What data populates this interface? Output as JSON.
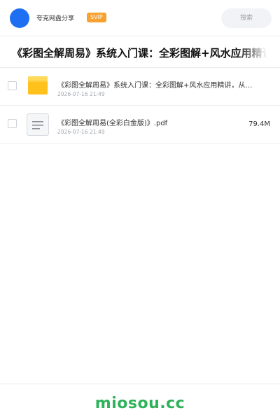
{
  "header": {
    "app_name": "夸克网盘分享",
    "badge": "SVIP",
    "search_placeholder": "搜索"
  },
  "title": "《彩图全解周易》系统入门课：全彩图解+风水应用精讲，从易经基础到实践，读懂古人的智慧",
  "files": [
    {
      "type": "folder",
      "name": "《彩图全解周易》系统入门课：全彩图解+风水应用精讲，从易经基础到实践",
      "date": "2026-07-16 21:49",
      "size": ""
    },
    {
      "type": "document",
      "name": "《彩图全解周易(全彩白金版)》.pdf",
      "date": "2026-07-16 21:49",
      "size": "79.4M"
    }
  ],
  "footer": {
    "brand": "miosou.cc"
  },
  "colors": {
    "avatar": "#1f6ff2",
    "svip_badge": "#f7a130",
    "folder": "#ffc21c",
    "brand": "#2fb25a"
  }
}
